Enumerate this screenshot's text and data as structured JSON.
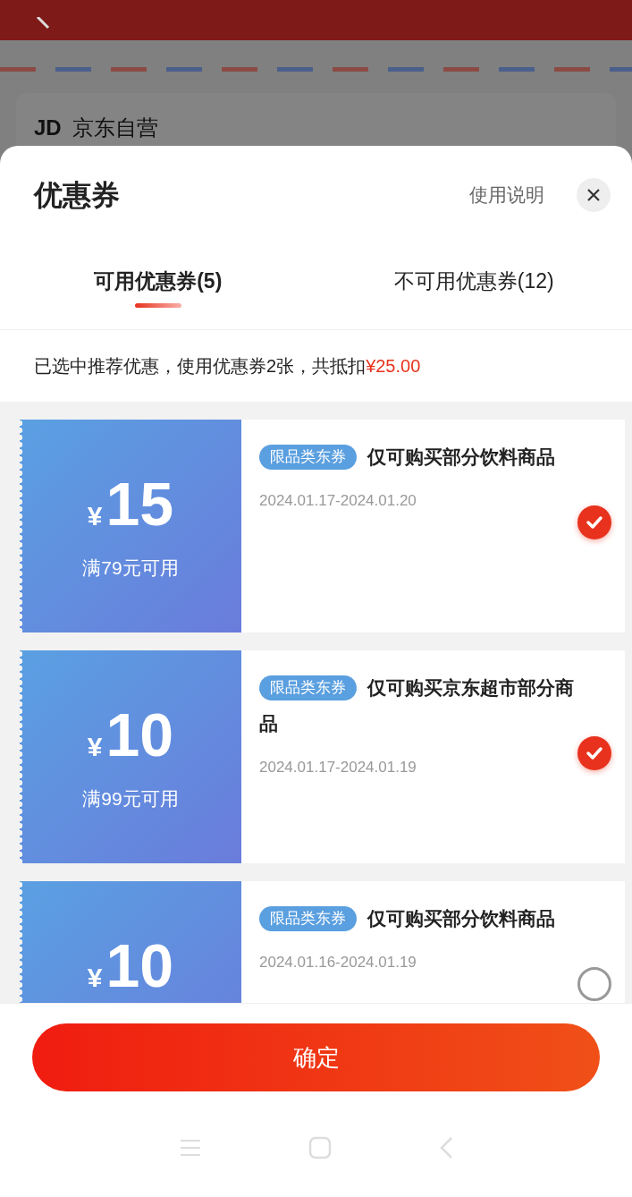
{
  "background": {
    "store_logo": "JD",
    "store_name": "京东自营"
  },
  "sheet": {
    "title": "优惠券",
    "help_link": "使用说明"
  },
  "tabs": [
    {
      "label": "可用优惠券(5)",
      "selected": true
    },
    {
      "label": "不可用优惠券(12)",
      "selected": false
    }
  ],
  "summary": {
    "text": "已选中推荐优惠，使用优惠券2张，共抵扣",
    "amount": "¥25.00"
  },
  "coupons": [
    {
      "currency": "¥",
      "amount": "15",
      "condition": "满79元可用",
      "tag": "限品类东券",
      "title": "仅可购买部分饮料商品",
      "dates": "2024.01.17-2024.01.20",
      "checked": true
    },
    {
      "currency": "¥",
      "amount": "10",
      "condition": "满99元可用",
      "tag": "限品类东券",
      "title": "仅可购买京东超市部分商品",
      "dates": "2024.01.17-2024.01.19",
      "checked": true
    },
    {
      "currency": "¥",
      "amount": "10",
      "tag": "限品类东券",
      "title": "仅可购买部分饮料商品",
      "dates": "2024.01.16-2024.01.19",
      "checked": false
    }
  ],
  "confirm_button": "确定"
}
